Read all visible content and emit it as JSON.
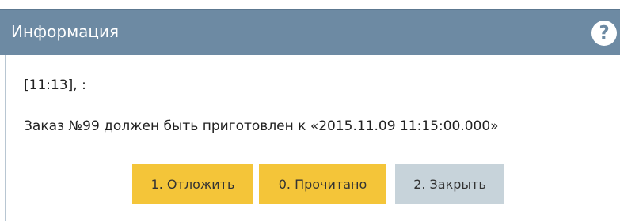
{
  "window": {
    "title": "Информация",
    "help_icon": "help-icon",
    "help_glyph": "?"
  },
  "message": {
    "time_line": "[11:13], :",
    "text": "Заказ №99 должен быть приготовлен к «2015.11.09 11:15:00.000»"
  },
  "buttons": {
    "postpone": "1. Отложить",
    "read": "0. Прочитано",
    "close": "2. Закрыть"
  },
  "colors": {
    "titlebar": "#6d8aa3",
    "primary_button": "#f4c539",
    "secondary_button": "#c7d3da"
  }
}
